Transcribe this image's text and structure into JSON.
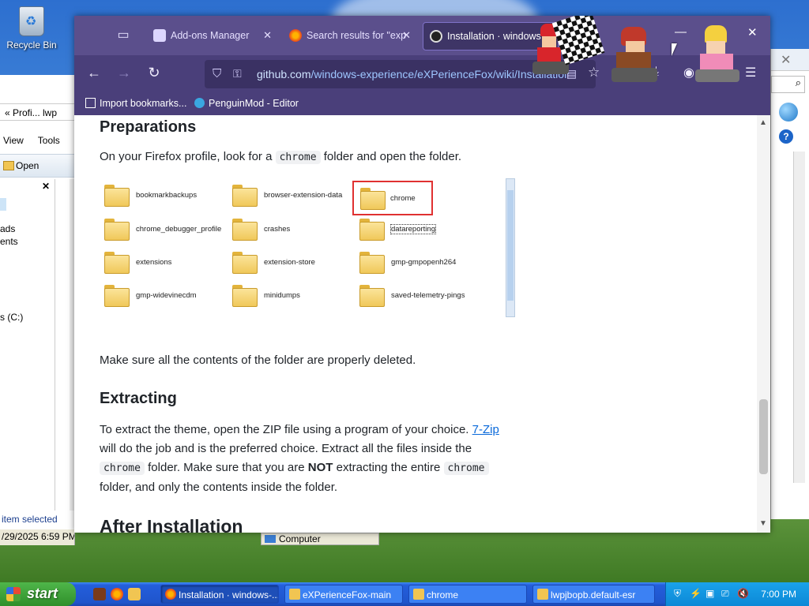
{
  "desktop": {
    "recycle_bin_label": "Recycle Bin"
  },
  "explorer": {
    "address": "« Profi...  lwp",
    "menu": [
      "View",
      "Tools"
    ],
    "open_label": "Open",
    "tree_items": [
      "ads",
      "ents",
      "s (C:)"
    ],
    "status": "item selected",
    "date": "/29/2025 6:59 PM",
    "computer_label": "Computer"
  },
  "firefox": {
    "tabs": [
      {
        "label": "Add-ons Manager"
      },
      {
        "label": "Search results for \"exp"
      },
      {
        "label": "Installation · windows"
      }
    ],
    "url_domain": "github.com",
    "url_path": "/windows-experience/eXPerienceFox/wiki/Installation",
    "bookmarks": [
      "Import bookmarks...",
      "PenguinMod - Editor"
    ]
  },
  "page": {
    "h_preparations": "Preparations",
    "p1_before": "On your Firefox profile, look for a",
    "p1_code": "chrome",
    "p1_after": "folder and open the folder.",
    "folders": [
      "bookmarkbackups",
      "browser-extension-data",
      "chrome",
      "chrome_debugger_profile",
      "crashes",
      "datareporting",
      "extensions",
      "extension-store",
      "gmp-gmpopenh264",
      "gmp-widevinecdm",
      "minidumps",
      "saved-telemetry-pings"
    ],
    "p2": "Make sure all the contents of the folder are properly deleted.",
    "h_extracting": "Extracting",
    "p3_a": "To extract the theme, open the ZIP file using a program of your choice.",
    "p3_link": "7-Zip",
    "p3_b": "will do the job and is the preferred choice. Extract all the files inside the",
    "p3_code1": "chrome",
    "p3_c": "folder. Make sure that you are",
    "p3_bold": "NOT",
    "p3_d": "extracting the entire",
    "p3_code2": "chrome",
    "p3_e": "folder, and only the contents inside the folder.",
    "h_after": "After Installation"
  },
  "taskbar": {
    "start_label": "start",
    "tasks": [
      {
        "label": "Installation · windows-..."
      },
      {
        "label": "eXPerienceFox-main"
      },
      {
        "label": "chrome"
      },
      {
        "label": "lwpjbopb.default-esr"
      }
    ],
    "clock": "7:00 PM"
  },
  "colors": {
    "tabbar": "#5b4f8c",
    "navbar": "#4a3f7a",
    "link": "#0969da",
    "selection_box": "#e03131",
    "taskbar": "#245edb",
    "start": "#3a9b34"
  }
}
